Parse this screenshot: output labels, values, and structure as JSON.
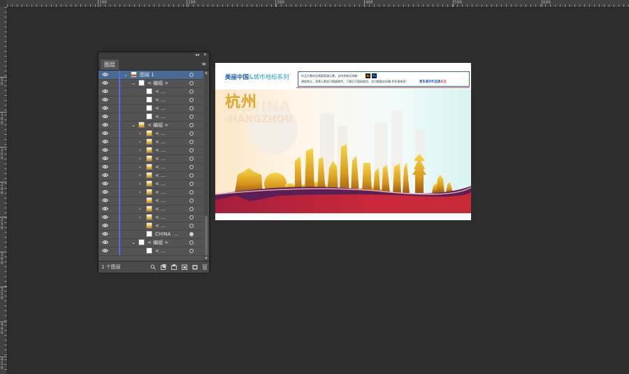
{
  "ruler_top": [
    "100",
    "200",
    "300",
    "400",
    "500",
    "600",
    "700"
  ],
  "ruler_left": [
    "50",
    "100",
    "150",
    "200",
    "250",
    "300",
    "350",
    "400",
    "450",
    "500"
  ],
  "panel": {
    "tab": "图层",
    "collapse_glyph": "◂◂",
    "close_glyph": "✕",
    "menu_glyph": "≡",
    "rows": [
      {
        "label": "图层 1",
        "twirl": "⌄",
        "thumb": "layer"
      },
      {
        "label": "< 编组 >",
        "twirl": "⌄",
        "thumb": "white"
      },
      {
        "label": "< ...",
        "twirl": "",
        "thumb": "white"
      },
      {
        "label": "< ...",
        "twirl": "",
        "thumb": "white"
      },
      {
        "label": "< ...",
        "twirl": "",
        "thumb": "white"
      },
      {
        "label": "< ...",
        "twirl": "",
        "thumb": "white"
      },
      {
        "label": "< 编组 >",
        "twirl": "⌄",
        "thumb": "gold"
      },
      {
        "label": "< ...",
        "twirl": "›",
        "thumb": "gold"
      },
      {
        "label": "< ...",
        "twirl": "›",
        "thumb": "gold"
      },
      {
        "label": "< ...",
        "twirl": "›",
        "thumb": "gold"
      },
      {
        "label": "< ...",
        "twirl": "›",
        "thumb": "gold"
      },
      {
        "label": "< ...",
        "twirl": "›",
        "thumb": "gold"
      },
      {
        "label": "< ...",
        "twirl": "›",
        "thumb": "gold"
      },
      {
        "label": "< ...",
        "twirl": "›",
        "thumb": "gold"
      },
      {
        "label": "< ...",
        "twirl": "›",
        "thumb": "gold"
      },
      {
        "label": "< ...",
        "twirl": "",
        "thumb": "gold"
      },
      {
        "label": "< ...",
        "twirl": "›",
        "thumb": "gold"
      },
      {
        "label": "< ...",
        "twirl": "›",
        "thumb": "gold"
      },
      {
        "label": "< ...",
        "twirl": "",
        "thumb": "gold"
      },
      {
        "label": "CHINA  ...",
        "twirl": "",
        "thumb": "white"
      },
      {
        "label": "< 编组 >",
        "twirl": "⌄",
        "thumb": "white"
      },
      {
        "label": "< ...",
        "twirl": "",
        "thumb": "white"
      }
    ],
    "footer_count": "1 个图层",
    "footer_icons": [
      "search-icon",
      "export-icon",
      "make-clip-mask-icon",
      "new-sublayer-icon",
      "new-layer-icon",
      "delete-icon"
    ]
  },
  "artboard": {
    "title_main": "美丽中国",
    "title_accent": "&城市地标系列",
    "info_line1": "作品为素材全格图案源元素，支持多格式改稿：",
    "info_line2": "建筑独立，背景元素皆可随意换色，下载后可直接使用，也可根据实际略 作任意修改！",
    "info_more": "更多城市作品请",
    "info_follow": "关注",
    "badge_ai": "Ai",
    "badge_ps": "Ps",
    "city": "杭州",
    "ghost": "CHINA",
    "sub": "-HANGZHOU",
    "colors": {
      "title_blue": "#1c5ea8",
      "city_gold": "#e0a62b",
      "wave_red": "#c8283a",
      "wave_purple": "#5a1f55"
    }
  }
}
